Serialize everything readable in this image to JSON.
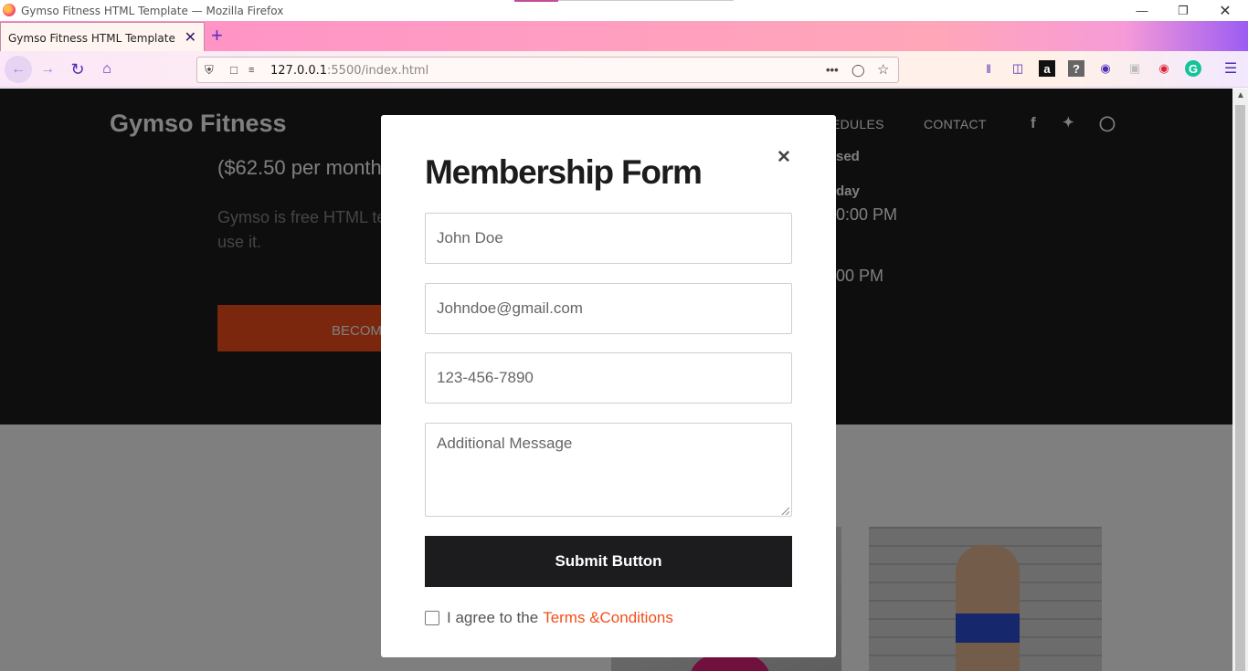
{
  "window": {
    "title": "Gymso Fitness HTML Template — Mozilla Firefox"
  },
  "tab": {
    "title": "Gymso Fitness HTML Template"
  },
  "url": {
    "host": "127.0.0.1",
    "path": ":5500/index.html"
  },
  "site": {
    "brand": "Gymso Fitness",
    "nav": [
      "EDULES",
      "CONTACT"
    ],
    "price": "($62.50 per month",
    "description": "Gymso is free HTML te commercial website. free to use it.",
    "cta": "BECOM",
    "schedule": {
      "closed": "sed",
      "day": "day",
      "time1": "0:00 PM",
      "time2": "00 PM"
    }
  },
  "modal": {
    "title": "Membership Form",
    "name_placeholder": "John Doe",
    "email_placeholder": "Johndoe@gmail.com",
    "phone_placeholder": "123-456-7890",
    "message_placeholder": "Additional Message",
    "submit_label": "Submit Button",
    "agree_text": "I agree to the",
    "terms_link": "Terms &Conditions"
  },
  "colors": {
    "accent": "#f44f1d",
    "dark": "#1c1c1e"
  }
}
